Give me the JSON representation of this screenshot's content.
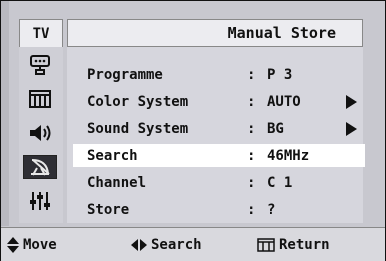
{
  "header": {
    "tv_label": "TV",
    "title": "Manual Store"
  },
  "sidebar": {
    "items": [
      {
        "name": "input-icon",
        "active": false
      },
      {
        "name": "picture-icon",
        "active": false
      },
      {
        "name": "sound-icon",
        "active": false
      },
      {
        "name": "channel-antenna-icon",
        "active": true
      },
      {
        "name": "setup-icon",
        "active": false
      }
    ]
  },
  "menu": {
    "rows": [
      {
        "label": "Programme",
        "colon": ":",
        "value": "P 3",
        "has_arrow": false,
        "selected": false
      },
      {
        "label": "Color System",
        "colon": ":",
        "value": "AUTO",
        "has_arrow": true,
        "selected": false
      },
      {
        "label": "Sound System",
        "colon": ":",
        "value": "BG",
        "has_arrow": true,
        "selected": false
      },
      {
        "label": "Search",
        "colon": ":",
        "value": "46MHz",
        "has_arrow": false,
        "selected": true
      },
      {
        "label": "Channel",
        "colon": ":",
        "value": "C 1",
        "has_arrow": false,
        "selected": false
      },
      {
        "label": "Store",
        "colon": ":",
        "value": "?",
        "has_arrow": false,
        "selected": false
      }
    ]
  },
  "footer": {
    "move_label": "Move",
    "search_label": "Search",
    "return_label": "Return"
  },
  "colors": {
    "background": "#c8c8cf",
    "selected_row": "#ffffff",
    "active_icon": "#2e2e34"
  }
}
